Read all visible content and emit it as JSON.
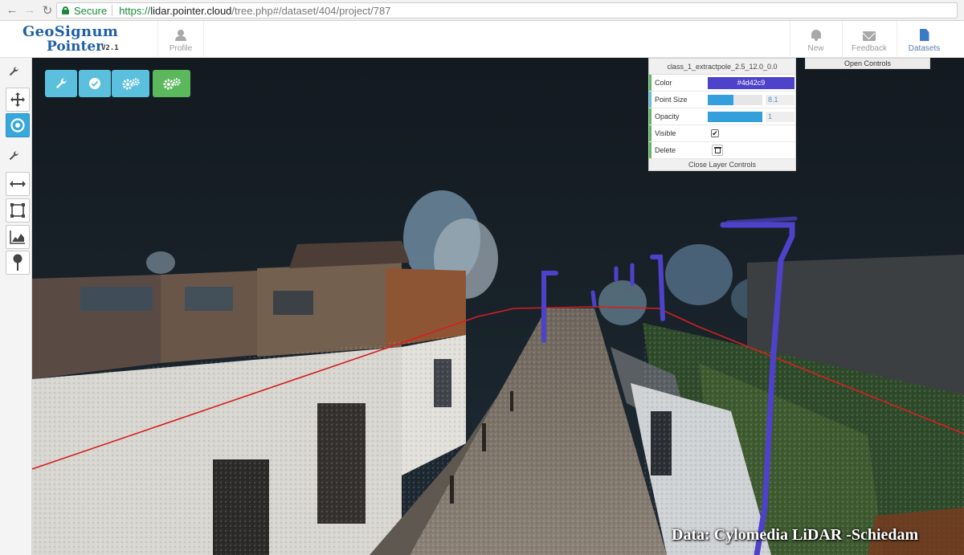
{
  "browser": {
    "secure_label": "Secure",
    "url_scheme": "https://",
    "url_host": "lidar.pointer.cloud",
    "url_path": "/tree.php#/dataset/404/project/787"
  },
  "app": {
    "logo_line1": "GeoSignum",
    "logo_line2": "Pointer",
    "logo_version": "V2.1",
    "tabs": {
      "profile": "Profile",
      "new": "New",
      "feedback": "Feedback",
      "datasets": "Datasets"
    }
  },
  "open_controls_label": "Open Controls",
  "layer_controls": {
    "title": "class_1_extractpole_2.5_12.0_0.0",
    "color_label": "Color",
    "color_value": "#4d42c9",
    "point_size_label": "Point Size",
    "point_size_value": "8.1",
    "point_size_fraction": 0.47,
    "opacity_label": "Opacity",
    "opacity_value": "1",
    "opacity_fraction": 1.0,
    "visible_label": "Visible",
    "visible_checked": true,
    "delete_label": "Delete",
    "close_label": "Close Layer Controls"
  },
  "watermark": "Data: Cylomedia LiDAR -Schiedam",
  "colors": {
    "tool_blue": "#5bc0de",
    "tool_green": "#5cb85c",
    "active_tool": "#37a8de",
    "pole_color": "#4d42c9",
    "profile_line": "#d42020"
  },
  "icons": {
    "left_toolbar": [
      "wrench-icon",
      "move-icon",
      "orbit-icon",
      "wrench-icon",
      "measure-distance-icon",
      "area-select-icon",
      "elevation-profile-icon",
      "map-pin-icon"
    ],
    "floating_tools": [
      "wrench-icon",
      "check-circle-icon",
      "gears-icon",
      "gears-icon"
    ]
  }
}
